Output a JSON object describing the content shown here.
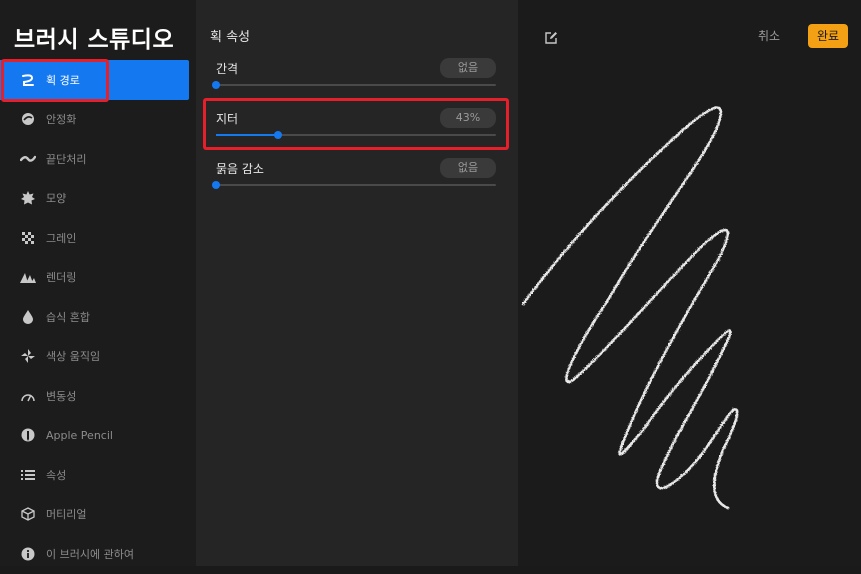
{
  "app_title": "브러시 스튜디오",
  "sidebar": {
    "items": [
      {
        "label": "획 경로",
        "icon": "stroke-path-icon",
        "active": true
      },
      {
        "label": "안정화",
        "icon": "stabilization-icon"
      },
      {
        "label": "끝단처리",
        "icon": "taper-icon"
      },
      {
        "label": "모양",
        "icon": "shape-icon"
      },
      {
        "label": "그레인",
        "icon": "grain-icon"
      },
      {
        "label": "렌더링",
        "icon": "rendering-icon"
      },
      {
        "label": "습식 혼합",
        "icon": "wet-mix-icon"
      },
      {
        "label": "색상 움직임",
        "icon": "color-dynamics-icon"
      },
      {
        "label": "변동성",
        "icon": "dynamics-icon"
      },
      {
        "label": "Apple Pencil",
        "icon": "apple-pencil-icon"
      },
      {
        "label": "속성",
        "icon": "properties-icon"
      },
      {
        "label": "머티리얼",
        "icon": "materials-icon"
      },
      {
        "label": "이 브러시에 관하여",
        "icon": "info-icon"
      }
    ]
  },
  "panel": {
    "title": "획 속성",
    "settings": [
      {
        "label": "간격",
        "value": "없음",
        "level": 0.0
      },
      {
        "label": "지터",
        "value": "43%",
        "level": 0.22
      },
      {
        "label": "묽음 감소",
        "value": "없음",
        "level": 0.0
      }
    ]
  },
  "toolbar": {
    "cancel_label": "취소",
    "done_label": "완료"
  },
  "colors": {
    "accent": "#1478f0",
    "done_button": "#f3a014",
    "highlight": "#e5202a"
  }
}
